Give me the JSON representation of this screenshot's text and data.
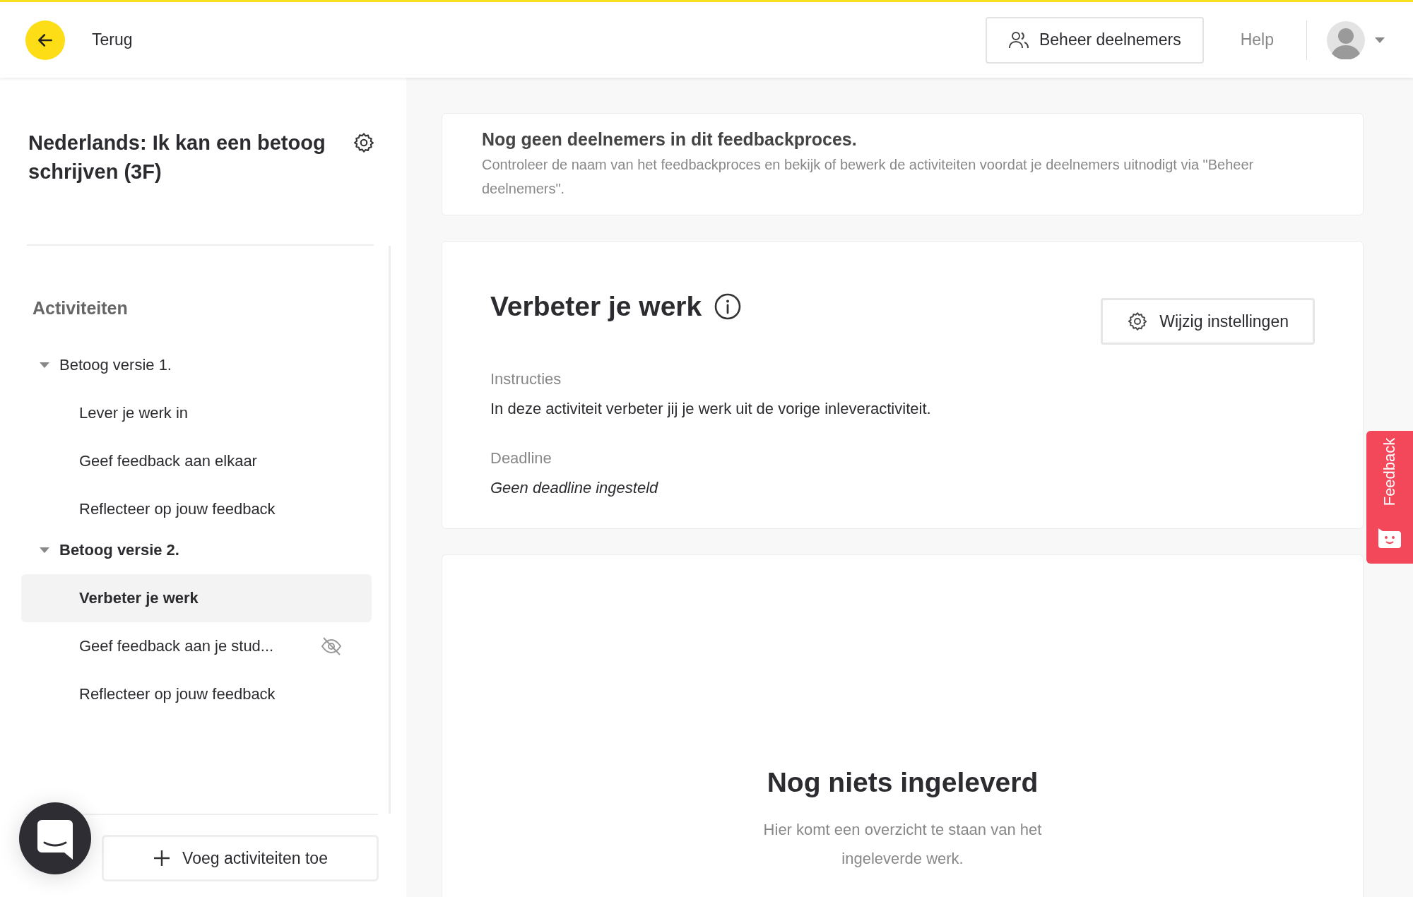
{
  "header": {
    "back_label": "Terug",
    "manage_button": "Beheer deelnemers",
    "help_link": "Help"
  },
  "sidebar": {
    "title": "Nederlands: Ik kan een betoog schrijven (3F)",
    "section_title": "Activiteiten",
    "groups": [
      {
        "label": "Betoog versie 1.",
        "expanded": true,
        "children": [
          {
            "label": "Lever je werk in",
            "selected": false,
            "hidden": false
          },
          {
            "label": "Geef feedback aan elkaar",
            "selected": false,
            "hidden": false
          },
          {
            "label": "Reflecteer op jouw feedback",
            "selected": false,
            "hidden": false
          }
        ]
      },
      {
        "label": "Betoog versie 2.",
        "expanded": true,
        "children": [
          {
            "label": "Verbeter je werk",
            "selected": true,
            "hidden": false
          },
          {
            "label": "Geef feedback aan je stud...",
            "selected": false,
            "hidden": true
          },
          {
            "label": "Reflecteer op jouw feedback",
            "selected": false,
            "hidden": false
          }
        ]
      }
    ],
    "add_button": "Voeg activiteiten toe"
  },
  "notice": {
    "title": "Nog geen deelnemers in dit feedbackproces.",
    "text": "Controleer de naam van het feedbackproces en bekijk of bewerk de activiteiten voordat je deelnemers uitnodigt via \"Beheer deelnemers\"."
  },
  "activity": {
    "title": "Verbeter je werk",
    "settings_button": "Wijzig instellingen",
    "instructions_label": "Instructies",
    "instructions": "In deze activiteit verbeter jij je werk uit de vorige inleveractiviteit.",
    "deadline_label": "Deadline",
    "deadline": "Geen deadline ingesteld"
  },
  "submissions": {
    "title": "Nog niets ingeleverd",
    "text": "Hier komt een overzicht te staan van het ingeleverde werk."
  },
  "feedback_tab": "Feedback"
}
